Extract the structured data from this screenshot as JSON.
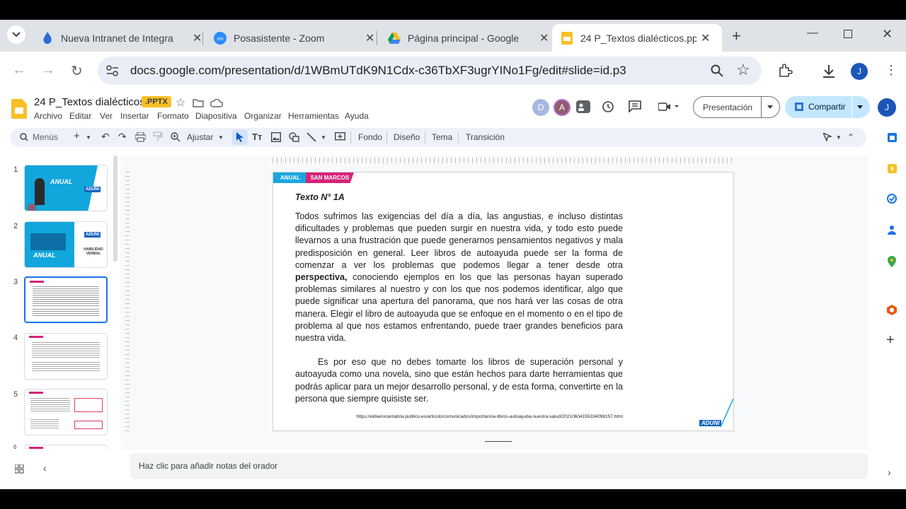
{
  "browser": {
    "tabs": [
      {
        "title": "Nueva Intranet de Integra",
        "icon": "intranet-flame-icon"
      },
      {
        "title": "Posasistente - Zoom",
        "icon": "zoom-icon"
      },
      {
        "title": "Página principal - Google",
        "icon": "google-drive-icon"
      },
      {
        "title": "24 P_Textos dialécticos.pp",
        "icon": "google-slides-icon"
      }
    ],
    "url": "docs.google.com/presentation/d/1WBmUTdK9N1Cdx-c36TbXF3ugrYINo1Fg/edit#slide=id.p3",
    "profile_initial": "J"
  },
  "doc": {
    "title": "24 P_Textos dialécticos",
    "badge": ".PPTX",
    "menus": [
      "Archivo",
      "Editar",
      "Ver",
      "Insertar",
      "Formato",
      "Diapositiva",
      "Organizar",
      "Herramientas",
      "Ayuda"
    ],
    "presence": [
      "D",
      "A"
    ],
    "present_label": "Presentación",
    "share_label": "Compartir",
    "user_initial": "J"
  },
  "toolbar": {
    "search_label": "Menús",
    "zoom_label": "Ajustar",
    "fondo": "Fondo",
    "diseno": "Diseño",
    "tema": "Tema",
    "transicion": "Transición"
  },
  "filmstrip": {
    "numbers": [
      "1",
      "2",
      "3",
      "4",
      "5",
      "6"
    ],
    "selected": 3
  },
  "slide": {
    "tag_anual": "ANUAL",
    "tag_sanmarcos": "SAN MARCOS",
    "heading": "Texto N° 1A",
    "p1_pre": "Todos sufrimos las exigencias del día a día, las angustias, e incluso distintas dificultades y problemas que pueden surgir en nuestra vida, y todo esto puede llevarnos a una frustración  que puede generarnos pensamientos negativos y mala predisposición en general. Leer libros de autoayuda puede ser la forma de comenzar a ver los problemas que podemos  llegar a tener desde otra ",
    "p1_bold": "perspectiva,",
    "p1_post": " conociendo ejemplos en los que las personas hayan superado problemas similares al nuestro y con los que nos podemos identificar, algo que puede significar una apertura del panorama, que nos hará ver las cosas de otra manera. Elegir el libro de autoayuda que se enfoque en el momento o en el tipo de problema al que nos estamos enfrentando, puede traer grandes beneficios para nuestra vida.",
    "p2": "Es por eso que no debes tomarte los libros de superación personal y autoayuda como una novela, sino que están hechos para darte herramientas que podrás aplicar para un mejor desarrollo personal, y de esta forma, convertirte en la persona que siempre quisiste ser.",
    "source": "https://eldiariocantabria.publico.es/articulo/comunicados/importancia-libros-autoayuda-nuestra-salud/20210604155334098157.html",
    "logo": "ADUNI"
  },
  "notes": {
    "placeholder": "Haz clic para añadir notas del orador"
  },
  "thumbs": {
    "t1": "ANUAL",
    "t1_logo": "ADUNI",
    "t2": "ANUAL",
    "t2_sub": "HABILIDAD VERBAL",
    "t2_logo": "ADUNI"
  },
  "colors": {
    "accent_blue": "#1a73e8",
    "slides_yellow": "#f6c026",
    "tag_cyan": "#1aa7e0",
    "tag_magenta": "#d6237a"
  }
}
